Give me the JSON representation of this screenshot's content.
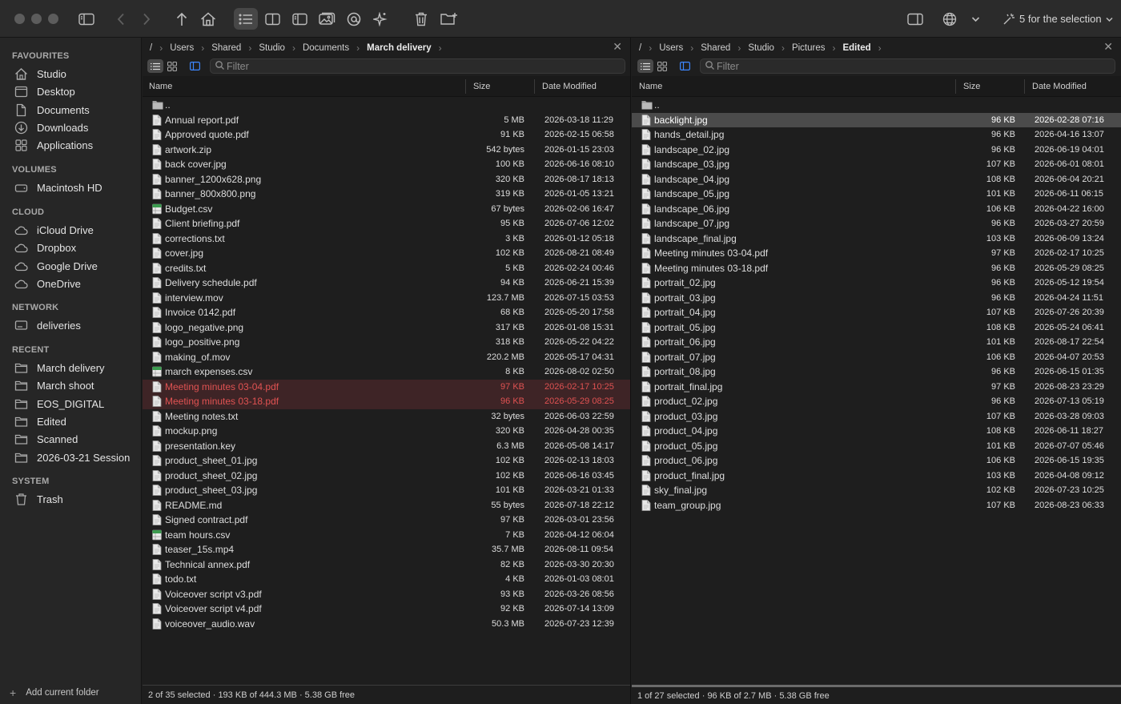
{
  "toolbar": {
    "selection_label": "5 for the selection",
    "icons": [
      "sidebar-icon",
      "back-icon",
      "forward-icon",
      "up-icon",
      "home-icon",
      "list-view-icon",
      "split-view-icon",
      "preview-pane-icon",
      "image-view-icon",
      "at-icon",
      "magic-icon",
      "trash-icon",
      "new-folder-icon",
      "panel-icon",
      "globe-icon",
      "chevron-down-icon",
      "sparkle-icon"
    ]
  },
  "sidebar": {
    "favourites_title": "FAVOURITES",
    "favourites": [
      {
        "label": "Studio",
        "icon": "home-icon"
      },
      {
        "label": "Desktop",
        "icon": "desktop-icon"
      },
      {
        "label": "Documents",
        "icon": "document-icon"
      },
      {
        "label": "Downloads",
        "icon": "download-icon"
      },
      {
        "label": "Applications",
        "icon": "applications-icon"
      }
    ],
    "volumes_title": "VOLUMES",
    "volumes": [
      {
        "label": "Macintosh HD",
        "icon": "disk-icon"
      }
    ],
    "cloud_title": "CLOUD",
    "cloud": [
      {
        "label": "iCloud Drive",
        "icon": "cloud-icon"
      },
      {
        "label": "Dropbox",
        "icon": "cloud-icon"
      },
      {
        "label": "Google Drive",
        "icon": "cloud-icon"
      },
      {
        "label": "OneDrive",
        "icon": "cloud-icon"
      }
    ],
    "network_title": "NETWORK",
    "network": [
      {
        "label": "deliveries",
        "icon": "network-drive-icon"
      }
    ],
    "recent_title": "RECENT",
    "recent": [
      {
        "label": "March delivery",
        "icon": "folder-icon"
      },
      {
        "label": "March shoot",
        "icon": "folder-icon"
      },
      {
        "label": "EOS_DIGITAL",
        "icon": "folder-icon"
      },
      {
        "label": "Edited",
        "icon": "folder-icon"
      },
      {
        "label": "Scanned",
        "icon": "folder-icon"
      },
      {
        "label": "2026-03-21 Session",
        "icon": "folder-icon"
      }
    ],
    "system_title": "SYSTEM",
    "system": [
      {
        "label": "Trash",
        "icon": "trash-icon"
      }
    ],
    "footer_label": "Add current folder"
  },
  "left_pane": {
    "path": [
      "/",
      "Users",
      "Shared",
      "Studio",
      "Documents",
      "March delivery"
    ],
    "filter_placeholder": "Filter",
    "columns": {
      "name": "Name",
      "size": "Size",
      "date": "Date Modified"
    },
    "parent_label": "..",
    "rows": [
      {
        "name": "Annual report.pdf",
        "size": "5 MB",
        "date": "2026-03-18 11:29"
      },
      {
        "name": "Approved quote.pdf",
        "size": "91 KB",
        "date": "2026-02-15 06:58"
      },
      {
        "name": "artwork.zip",
        "size": "542 bytes",
        "date": "2026-01-15 23:03"
      },
      {
        "name": "back cover.jpg",
        "size": "100 KB",
        "date": "2026-06-16 08:10"
      },
      {
        "name": "banner_1200x628.png",
        "size": "320 KB",
        "date": "2026-08-17 18:13"
      },
      {
        "name": "banner_800x800.png",
        "size": "319 KB",
        "date": "2026-01-05 13:21"
      },
      {
        "name": "Budget.csv",
        "size": "67 bytes",
        "date": "2026-02-06 16:47",
        "icon": "spreadsheet"
      },
      {
        "name": "Client briefing.pdf",
        "size": "95 KB",
        "date": "2026-07-06 12:02"
      },
      {
        "name": "corrections.txt",
        "size": "3 KB",
        "date": "2026-01-12 05:18"
      },
      {
        "name": "cover.jpg",
        "size": "102 KB",
        "date": "2026-08-21 08:49"
      },
      {
        "name": "credits.txt",
        "size": "5 KB",
        "date": "2026-02-24 00:46"
      },
      {
        "name": "Delivery schedule.pdf",
        "size": "94 KB",
        "date": "2026-06-21 15:39"
      },
      {
        "name": "interview.mov",
        "size": "123.7 MB",
        "date": "2026-07-15 03:53"
      },
      {
        "name": "Invoice 0142.pdf",
        "size": "68 KB",
        "date": "2026-05-20 17:58"
      },
      {
        "name": "logo_negative.png",
        "size": "317 KB",
        "date": "2026-01-08 15:31"
      },
      {
        "name": "logo_positive.png",
        "size": "318 KB",
        "date": "2026-05-22 04:22"
      },
      {
        "name": "making_of.mov",
        "size": "220.2 MB",
        "date": "2026-05-17 04:31"
      },
      {
        "name": "march expenses.csv",
        "size": "8 KB",
        "date": "2026-08-02 02:50",
        "icon": "spreadsheet"
      },
      {
        "name": "Meeting minutes 03-04.pdf",
        "size": "97 KB",
        "date": "2026-02-17 10:25",
        "state": "selected"
      },
      {
        "name": "Meeting minutes 03-18.pdf",
        "size": "96 KB",
        "date": "2026-05-29 08:25",
        "state": "selected"
      },
      {
        "name": "Meeting notes.txt",
        "size": "32 bytes",
        "date": "2026-06-03 22:59"
      },
      {
        "name": "mockup.png",
        "size": "320 KB",
        "date": "2026-04-28 00:35"
      },
      {
        "name": "presentation.key",
        "size": "6.3 MB",
        "date": "2026-05-08 14:17"
      },
      {
        "name": "product_sheet_01.jpg",
        "size": "102 KB",
        "date": "2026-02-13 18:03"
      },
      {
        "name": "product_sheet_02.jpg",
        "size": "102 KB",
        "date": "2026-06-16 03:45"
      },
      {
        "name": "product_sheet_03.jpg",
        "size": "101 KB",
        "date": "2026-03-21 01:33"
      },
      {
        "name": "README.md",
        "size": "55 bytes",
        "date": "2026-07-18 22:12"
      },
      {
        "name": "Signed contract.pdf",
        "size": "97 KB",
        "date": "2026-03-01 23:56"
      },
      {
        "name": "team hours.csv",
        "size": "7 KB",
        "date": "2026-04-12 06:04",
        "icon": "spreadsheet"
      },
      {
        "name": "teaser_15s.mp4",
        "size": "35.7 MB",
        "date": "2026-08-11 09:54"
      },
      {
        "name": "Technical annex.pdf",
        "size": "82 KB",
        "date": "2026-03-30 20:30"
      },
      {
        "name": "todo.txt",
        "size": "4 KB",
        "date": "2026-01-03 08:01"
      },
      {
        "name": "Voiceover script v3.pdf",
        "size": "93 KB",
        "date": "2026-03-26 08:56"
      },
      {
        "name": "Voiceover script v4.pdf",
        "size": "92 KB",
        "date": "2026-07-14 13:09"
      },
      {
        "name": "voiceover_audio.wav",
        "size": "50.3 MB",
        "date": "2026-07-23 12:39"
      }
    ],
    "status": "2 of 35 selected · 193 KB of 444.3 MB · 5.38 GB free"
  },
  "right_pane": {
    "path": [
      "/",
      "Users",
      "Shared",
      "Studio",
      "Pictures",
      "Edited"
    ],
    "filter_placeholder": "Filter",
    "columns": {
      "name": "Name",
      "size": "Size",
      "date": "Date Modified"
    },
    "parent_label": "..",
    "rows": [
      {
        "name": "backlight.jpg",
        "size": "96 KB",
        "date": "2026-02-28 07:16",
        "state": "cursor"
      },
      {
        "name": "hands_detail.jpg",
        "size": "96 KB",
        "date": "2026-04-16 13:07"
      },
      {
        "name": "landscape_02.jpg",
        "size": "96 KB",
        "date": "2026-06-19 04:01"
      },
      {
        "name": "landscape_03.jpg",
        "size": "107 KB",
        "date": "2026-06-01 08:01"
      },
      {
        "name": "landscape_04.jpg",
        "size": "108 KB",
        "date": "2026-06-04 20:21"
      },
      {
        "name": "landscape_05.jpg",
        "size": "101 KB",
        "date": "2026-06-11 06:15"
      },
      {
        "name": "landscape_06.jpg",
        "size": "106 KB",
        "date": "2026-04-22 16:00"
      },
      {
        "name": "landscape_07.jpg",
        "size": "96 KB",
        "date": "2026-03-27 20:59"
      },
      {
        "name": "landscape_final.jpg",
        "size": "103 KB",
        "date": "2026-06-09 13:24"
      },
      {
        "name": "Meeting minutes 03-04.pdf",
        "size": "97 KB",
        "date": "2026-02-17 10:25"
      },
      {
        "name": "Meeting minutes 03-18.pdf",
        "size": "96 KB",
        "date": "2026-05-29 08:25"
      },
      {
        "name": "portrait_02.jpg",
        "size": "96 KB",
        "date": "2026-05-12 19:54"
      },
      {
        "name": "portrait_03.jpg",
        "size": "96 KB",
        "date": "2026-04-24 11:51"
      },
      {
        "name": "portrait_04.jpg",
        "size": "107 KB",
        "date": "2026-07-26 20:39"
      },
      {
        "name": "portrait_05.jpg",
        "size": "108 KB",
        "date": "2026-05-24 06:41"
      },
      {
        "name": "portrait_06.jpg",
        "size": "101 KB",
        "date": "2026-08-17 22:54"
      },
      {
        "name": "portrait_07.jpg",
        "size": "106 KB",
        "date": "2026-04-07 20:53"
      },
      {
        "name": "portrait_08.jpg",
        "size": "96 KB",
        "date": "2026-06-15 01:35"
      },
      {
        "name": "portrait_final.jpg",
        "size": "97 KB",
        "date": "2026-08-23 23:29"
      },
      {
        "name": "product_02.jpg",
        "size": "96 KB",
        "date": "2026-07-13 05:19"
      },
      {
        "name": "product_03.jpg",
        "size": "107 KB",
        "date": "2026-03-28 09:03"
      },
      {
        "name": "product_04.jpg",
        "size": "108 KB",
        "date": "2026-06-11 18:27"
      },
      {
        "name": "product_05.jpg",
        "size": "101 KB",
        "date": "2026-07-07 05:46"
      },
      {
        "name": "product_06.jpg",
        "size": "106 KB",
        "date": "2026-06-15 19:35"
      },
      {
        "name": "product_final.jpg",
        "size": "103 KB",
        "date": "2026-04-08 09:12"
      },
      {
        "name": "sky_final.jpg",
        "size": "102 KB",
        "date": "2026-07-23 10:25"
      },
      {
        "name": "team_group.jpg",
        "size": "107 KB",
        "date": "2026-08-23 06:33"
      }
    ],
    "status": "1 of 27 selected · 96 KB of 2.7 MB · 5.38 GB free"
  },
  "colors": {
    "selected_text": "#e05252",
    "selected_bg": "#3e2426",
    "cursor_bg": "#4b4b4b",
    "accent": "#3d86ff"
  }
}
